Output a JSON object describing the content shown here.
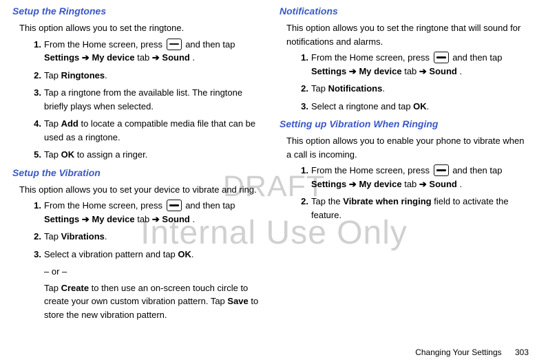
{
  "watermark": {
    "line1": "DRAFT",
    "line2": "Internal Use Only"
  },
  "left": {
    "s1": {
      "heading": "Setup the Ringtones",
      "intro": "This option allows you to set the ringtone.",
      "items": [
        {
          "n": "1.",
          "pre": "From the Home screen, press ",
          "post": " and then tap ",
          "b1": "Settings",
          "arr1": " ➔ ",
          "b2": "My device",
          "mid": " tab ",
          "arr2": "➔ ",
          "b3": "Sound",
          "end": "."
        },
        {
          "n": "2.",
          "pre": "Tap ",
          "b1": "Ringtones",
          "end": "."
        },
        {
          "n": "3.",
          "text": "Tap a ringtone from the available list. The ringtone briefly plays when selected."
        },
        {
          "n": "4.",
          "pre": "Tap ",
          "b1": "Add",
          "post": " to locate a compatible media file that can be used as a ringtone."
        },
        {
          "n": "5.",
          "pre": "Tap ",
          "b1": "OK",
          "post": " to assign a ringer."
        }
      ]
    },
    "s2": {
      "heading": "Setup the Vibration",
      "intro": "This option allows you to set your device to vibrate and ring.",
      "items": [
        {
          "n": "1.",
          "pre": "From the Home screen, press ",
          "post": " and then tap ",
          "b1": "Settings",
          "arr1": " ➔ ",
          "b2": "My device",
          "mid": " tab ",
          "arr2": "➔ ",
          "b3": "Sound",
          "end": "."
        },
        {
          "n": "2.",
          "pre": "Tap ",
          "b1": "Vibrations",
          "end": "."
        },
        {
          "n": "3.",
          "pre": "Select a vibration pattern and tap ",
          "b1": "OK",
          "end": "."
        }
      ],
      "or": "– or –",
      "sub": {
        "pre": "Tap ",
        "b1": "Create",
        "mid": " to then use an on-screen touch circle to create your own custom vibration pattern. Tap ",
        "b2": "Save",
        "end": " to store the new vibration pattern."
      }
    }
  },
  "right": {
    "s1": {
      "heading": "Notifications",
      "intro": "This option allows you to set the ringtone that will sound for notifications and alarms.",
      "items": [
        {
          "n": "1.",
          "pre": "From the Home screen, press ",
          "post": " and then tap ",
          "b1": "Settings",
          "arr1": " ➔ ",
          "b2": "My device",
          "mid": " tab ",
          "arr2": "➔ ",
          "b3": "Sound",
          "end": "."
        },
        {
          "n": "2.",
          "pre": "Tap ",
          "b1": "Notifications",
          "end": "."
        },
        {
          "n": "3.",
          "pre": "Select a ringtone and tap ",
          "b1": "OK",
          "end": "."
        }
      ]
    },
    "s2": {
      "heading": "Setting up Vibration When Ringing",
      "intro": "This option allows you to enable your phone to vibrate when a call is incoming.",
      "items": [
        {
          "n": "1.",
          "pre": "From the Home screen, press ",
          "post": " and then tap ",
          "b1": "Settings",
          "arr1": " ➔ ",
          "b2": "My device",
          "mid": " tab ",
          "arr2": "➔ ",
          "b3": "Sound",
          "end": "."
        },
        {
          "n": "2.",
          "pre": "Tap the ",
          "b1": "Vibrate when ringing",
          "post": " field to activate the feature."
        }
      ]
    }
  },
  "footer": {
    "section": "Changing Your Settings",
    "page": "303"
  }
}
